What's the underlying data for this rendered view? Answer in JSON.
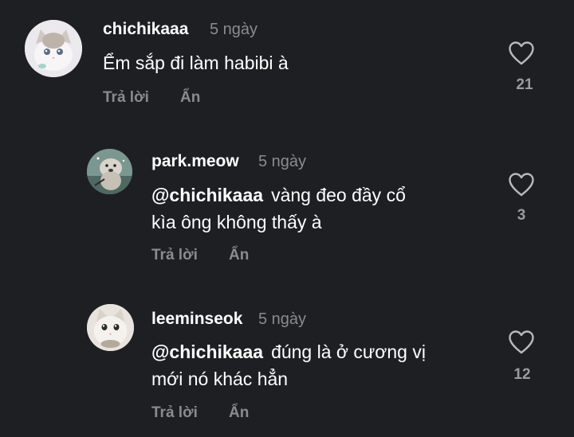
{
  "comments": [
    {
      "username": "chichikaaa",
      "time": "5 ngày",
      "text": "Ểm sắp đi làm habibi à",
      "reply_label": "Trả lời",
      "hide_label": "Ẩn",
      "likes": "21"
    },
    {
      "username": "park.meow",
      "time": "5 ngày",
      "mention": "@chichikaaa",
      "line1": "vàng đeo đầy cổ",
      "line2": "kìa ông không thấy à",
      "reply_label": "Trả lời",
      "hide_label": "Ẩn",
      "likes": "3"
    },
    {
      "username": "leeminseok",
      "time": "5 ngày",
      "mention": "@chichikaaa",
      "line1": "đúng là ở cương vị",
      "line2": "mới nó khác hẳn",
      "reply_label": "Trả lời",
      "hide_label": "Ẩn",
      "likes": "12"
    }
  ],
  "icons": {
    "like": "heart-outline-icon"
  },
  "colors": {
    "background": "#1e1f23",
    "text": "#ffffff",
    "muted": "#8a8b90"
  }
}
